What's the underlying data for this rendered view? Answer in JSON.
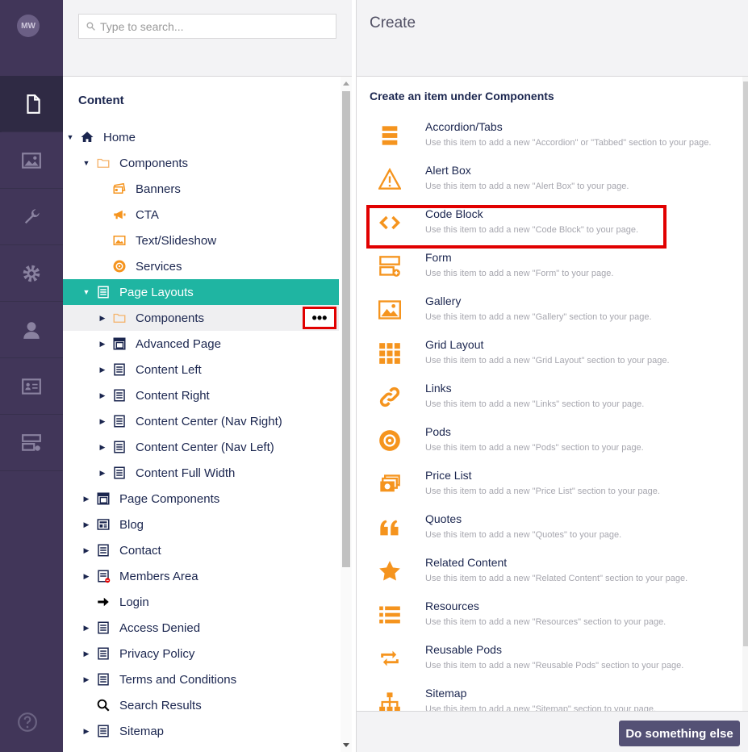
{
  "user": {
    "initials": "MW"
  },
  "rail": {
    "items": [
      {
        "icon": "document-icon",
        "active": true
      },
      {
        "icon": "media-icon",
        "active": false
      },
      {
        "icon": "wrench-icon",
        "active": false
      },
      {
        "icon": "gear-icon",
        "active": false
      },
      {
        "icon": "user-icon",
        "active": false
      },
      {
        "icon": "contact-card-icon",
        "active": false
      },
      {
        "icon": "form-icon",
        "active": false
      }
    ],
    "help_icon": "help-icon"
  },
  "search": {
    "placeholder": "Type to search..."
  },
  "tree": {
    "heading": "Content",
    "nodes": [
      {
        "label": "Home",
        "icon": "home-icon",
        "level": 0,
        "caret": "down"
      },
      {
        "label": "Components",
        "icon": "folder-icon",
        "level": 1,
        "caret": "down"
      },
      {
        "label": "Banners",
        "icon": "banners-icon",
        "level": 2,
        "caret": ""
      },
      {
        "label": "CTA",
        "icon": "megaphone-icon",
        "level": 2,
        "caret": ""
      },
      {
        "label": "Text/Slideshow",
        "icon": "image-icon",
        "level": 2,
        "caret": ""
      },
      {
        "label": "Services",
        "icon": "target-icon",
        "level": 2,
        "caret": ""
      },
      {
        "label": "Page Layouts",
        "icon": "page-icon",
        "level": 1,
        "caret": "down",
        "state": "selected"
      },
      {
        "label": "Components",
        "icon": "folder-icon",
        "level": 2,
        "caret": "right",
        "state": "hover"
      },
      {
        "label": "Advanced Page",
        "icon": "layout-icon",
        "level": 2,
        "caret": "right"
      },
      {
        "label": "Content Left",
        "icon": "page-icon",
        "level": 2,
        "caret": "right"
      },
      {
        "label": "Content Right",
        "icon": "page-icon",
        "level": 2,
        "caret": "right"
      },
      {
        "label": "Content Center (Nav Right)",
        "icon": "page-icon",
        "level": 2,
        "caret": "right"
      },
      {
        "label": "Content Center (Nav Left)",
        "icon": "page-icon",
        "level": 2,
        "caret": "right"
      },
      {
        "label": "Content Full Width",
        "icon": "page-icon",
        "level": 2,
        "caret": "right"
      },
      {
        "label": "Page Components",
        "icon": "layout-icon",
        "level": 1,
        "caret": "right"
      },
      {
        "label": "Blog",
        "icon": "newspaper-icon",
        "level": 1,
        "caret": "right"
      },
      {
        "label": "Contact",
        "icon": "page-icon",
        "level": 1,
        "caret": "right"
      },
      {
        "label": "Members Area",
        "icon": "page-restricted-icon",
        "level": 1,
        "caret": "right"
      },
      {
        "label": "Login",
        "icon": "arrow-right-icon",
        "level": 1,
        "caret": ""
      },
      {
        "label": "Access Denied",
        "icon": "page-icon",
        "level": 1,
        "caret": "right"
      },
      {
        "label": "Privacy Policy",
        "icon": "page-icon",
        "level": 1,
        "caret": "right"
      },
      {
        "label": "Terms and Conditions",
        "icon": "page-icon",
        "level": 1,
        "caret": "right"
      },
      {
        "label": "Search Results",
        "icon": "search-icon",
        "level": 1,
        "caret": ""
      },
      {
        "label": "Sitemap",
        "icon": "page-icon",
        "level": 1,
        "caret": "right"
      }
    ],
    "actions_button_label": "•••"
  },
  "create": {
    "title": "Create",
    "heading": "Create an item under Components",
    "items": [
      {
        "name": "Accordion/Tabs",
        "desc": "Use this item to add a new \"Accordion\" or \"Tabbed\" section to your page.",
        "icon": "accordion-icon"
      },
      {
        "name": "Alert Box",
        "desc": "Use this item to add a new \"Alert Box\" to your page.",
        "icon": "alert-icon"
      },
      {
        "name": "Code Block",
        "desc": "Use this item to add a new \"Code Block\" to your page.",
        "icon": "code-icon"
      },
      {
        "name": "Form",
        "desc": "Use this item to add a new \"Form\" to your page.",
        "icon": "form-icon"
      },
      {
        "name": "Gallery",
        "desc": "Use this item to add a new \"Gallery\" section to your page.",
        "icon": "gallery-icon"
      },
      {
        "name": "Grid Layout",
        "desc": "Use this item to add a new \"Grid Layout\" section to your page.",
        "icon": "grid-icon"
      },
      {
        "name": "Links",
        "desc": "Use this item to add a new \"Links\" section to your page.",
        "icon": "link-icon"
      },
      {
        "name": "Pods",
        "desc": "Use this item to add a new \"Pods\" section to your page.",
        "icon": "target-icon"
      },
      {
        "name": "Price List",
        "desc": "Use this item to add a new \"Price List\" section to your page.",
        "icon": "money-icon"
      },
      {
        "name": "Quotes",
        "desc": "Use this item to add a new \"Quotes\" to your page.",
        "icon": "quote-icon"
      },
      {
        "name": "Related Content",
        "desc": "Use this item to add a new \"Related Content\" section to your page.",
        "icon": "star-icon"
      },
      {
        "name": "Resources",
        "desc": "Use this item to add a new \"Resources\" section to your page.",
        "icon": "list-icon"
      },
      {
        "name": "Reusable Pods",
        "desc": "Use this item to add a new \"Reusable Pods\" section to your page.",
        "icon": "reuse-icon"
      },
      {
        "name": "Sitemap",
        "desc": "Use this item to add a new \"Sitemap\" section to your page.",
        "icon": "sitemap-icon"
      }
    ],
    "highlighted_item": "Code Block",
    "do_something_else_label": "Do something else"
  },
  "colors": {
    "rail": "#413659",
    "selected": "#1fb5a2",
    "accent_orange": "#f5941e",
    "highlight_red": "#e10000",
    "button": "#545175"
  }
}
